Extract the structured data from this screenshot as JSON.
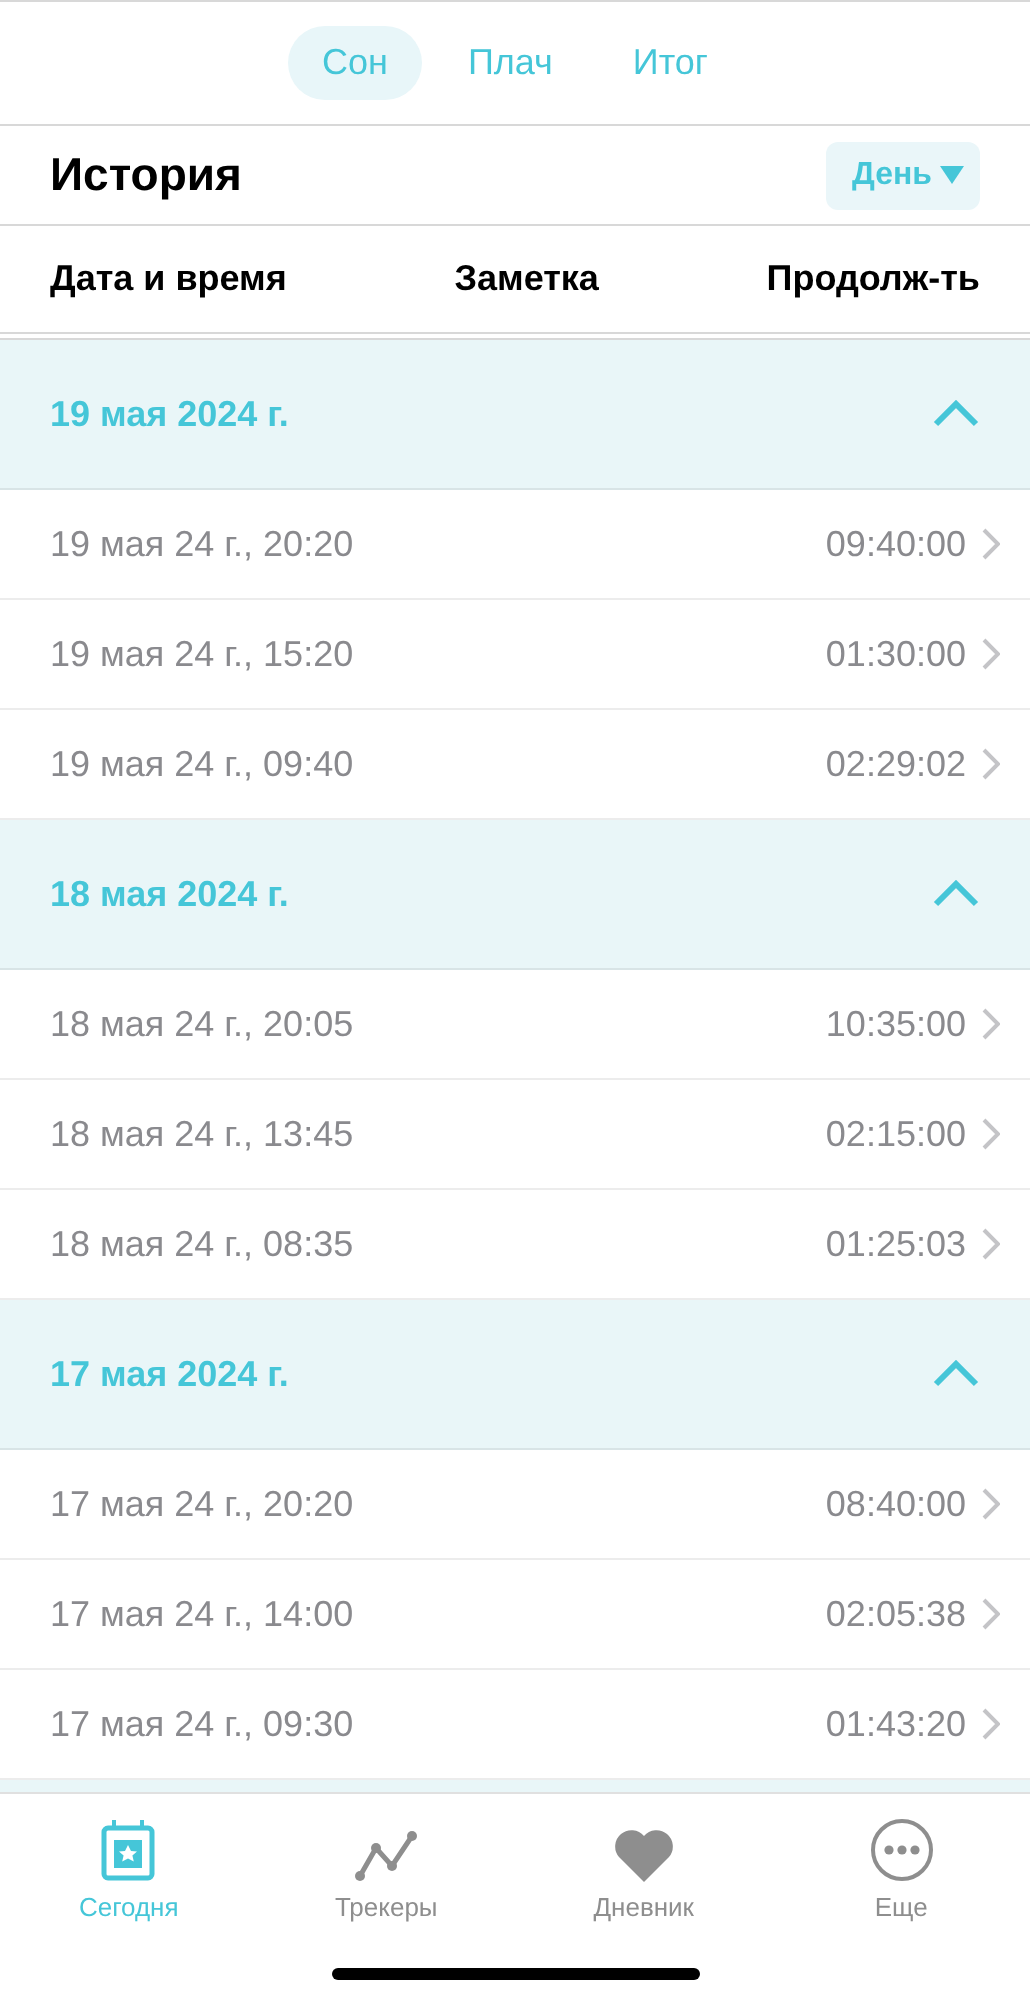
{
  "tabs": [
    {
      "label": "Сон",
      "selected": true
    },
    {
      "label": "Плач",
      "selected": false
    },
    {
      "label": "Итог",
      "selected": false
    }
  ],
  "history": {
    "title": "История",
    "period": "День"
  },
  "columns": [
    "Дата и время",
    "Заметка",
    "Продолж-ть"
  ],
  "groups": [
    {
      "date": "19 мая 2024 г.",
      "expanded": true,
      "rows": [
        {
          "datetime": "19 мая 24 г., 20:20",
          "duration": "09:40:00"
        },
        {
          "datetime": "19 мая 24 г., 15:20",
          "duration": "01:30:00"
        },
        {
          "datetime": "19 мая 24 г., 09:40",
          "duration": "02:29:02"
        }
      ]
    },
    {
      "date": "18 мая 2024 г.",
      "expanded": true,
      "rows": [
        {
          "datetime": "18 мая 24 г., 20:05",
          "duration": "10:35:00"
        },
        {
          "datetime": "18 мая 24 г., 13:45",
          "duration": "02:15:00"
        },
        {
          "datetime": "18 мая 24 г., 08:35",
          "duration": "01:25:03"
        }
      ]
    },
    {
      "date": "17 мая 2024 г.",
      "expanded": true,
      "rows": [
        {
          "datetime": "17 мая 24 г., 20:20",
          "duration": "08:40:00"
        },
        {
          "datetime": "17 мая 24 г., 14:00",
          "duration": "02:05:38"
        },
        {
          "datetime": "17 мая 24 г., 09:30",
          "duration": "01:43:20"
        }
      ]
    }
  ],
  "nav": [
    {
      "kind": "today",
      "label": "Сегодня",
      "selected": true
    },
    {
      "kind": "trackers",
      "label": "Трекеры",
      "selected": false
    },
    {
      "kind": "diary",
      "label": "Дневник",
      "selected": false
    },
    {
      "kind": "more",
      "label": "Еще",
      "selected": false
    }
  ]
}
